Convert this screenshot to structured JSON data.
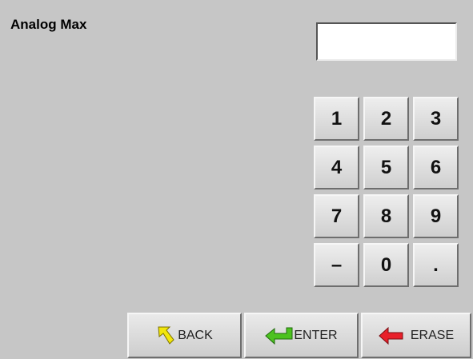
{
  "screen": {
    "title": "Analog Max",
    "display_value": ""
  },
  "keypad": {
    "keys": [
      "1",
      "2",
      "3",
      "4",
      "5",
      "6",
      "7",
      "8",
      "9",
      "–",
      "0",
      "."
    ]
  },
  "actions": {
    "back_label": "BACK",
    "enter_label": "ENTER",
    "erase_label": "ERASE",
    "back_icon": "back-arrow-icon",
    "enter_icon": "enter-arrow-icon",
    "erase_icon": "erase-arrow-icon"
  },
  "colors": {
    "background": "#c6c6c6",
    "back_icon": "#f2e60a",
    "enter_icon": "#4cc21f",
    "erase_icon": "#e8202a"
  }
}
